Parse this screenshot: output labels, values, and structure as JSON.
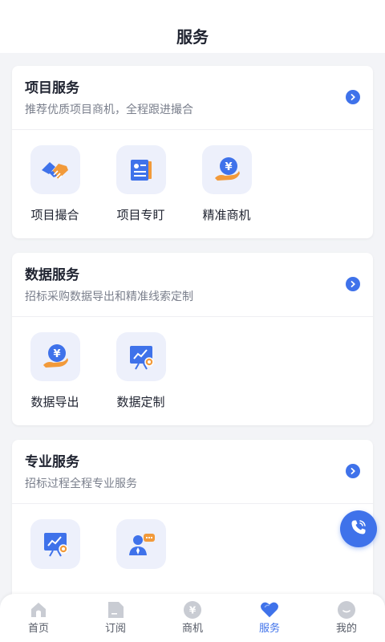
{
  "header": {
    "title": "服务"
  },
  "sections": [
    {
      "title": "项目服务",
      "subtitle": "推荐优质项目商机，全程跟进撮合",
      "items": [
        {
          "label": "项目撮合",
          "icon": "handshake-icon"
        },
        {
          "label": "项目专盯",
          "icon": "document-icon"
        },
        {
          "label": "精准商机",
          "icon": "yen-hand-icon"
        }
      ]
    },
    {
      "title": "数据服务",
      "subtitle": "招标采购数据导出和精准线索定制",
      "items": [
        {
          "label": "数据导出",
          "icon": "yen-hand-icon"
        },
        {
          "label": "数据定制",
          "icon": "presentation-chart-icon"
        }
      ]
    },
    {
      "title": "专业服务",
      "subtitle": "招标过程全程专业服务",
      "items": [
        {
          "label": "",
          "icon": "presentation-chart-icon"
        },
        {
          "label": "",
          "icon": "consultant-icon"
        }
      ]
    }
  ],
  "tabbar": {
    "tabs": [
      {
        "label": "首页",
        "icon": "home-icon"
      },
      {
        "label": "订阅",
        "icon": "subscribe-icon"
      },
      {
        "label": "商机",
        "icon": "yen-coin-icon"
      },
      {
        "label": "服务",
        "icon": "heart-icon",
        "active": true
      },
      {
        "label": "我的",
        "icon": "profile-icon"
      }
    ]
  },
  "colors": {
    "accent": "#3f72ea",
    "orange": "#f29a3a",
    "tile_bg": "#edf0fb"
  }
}
